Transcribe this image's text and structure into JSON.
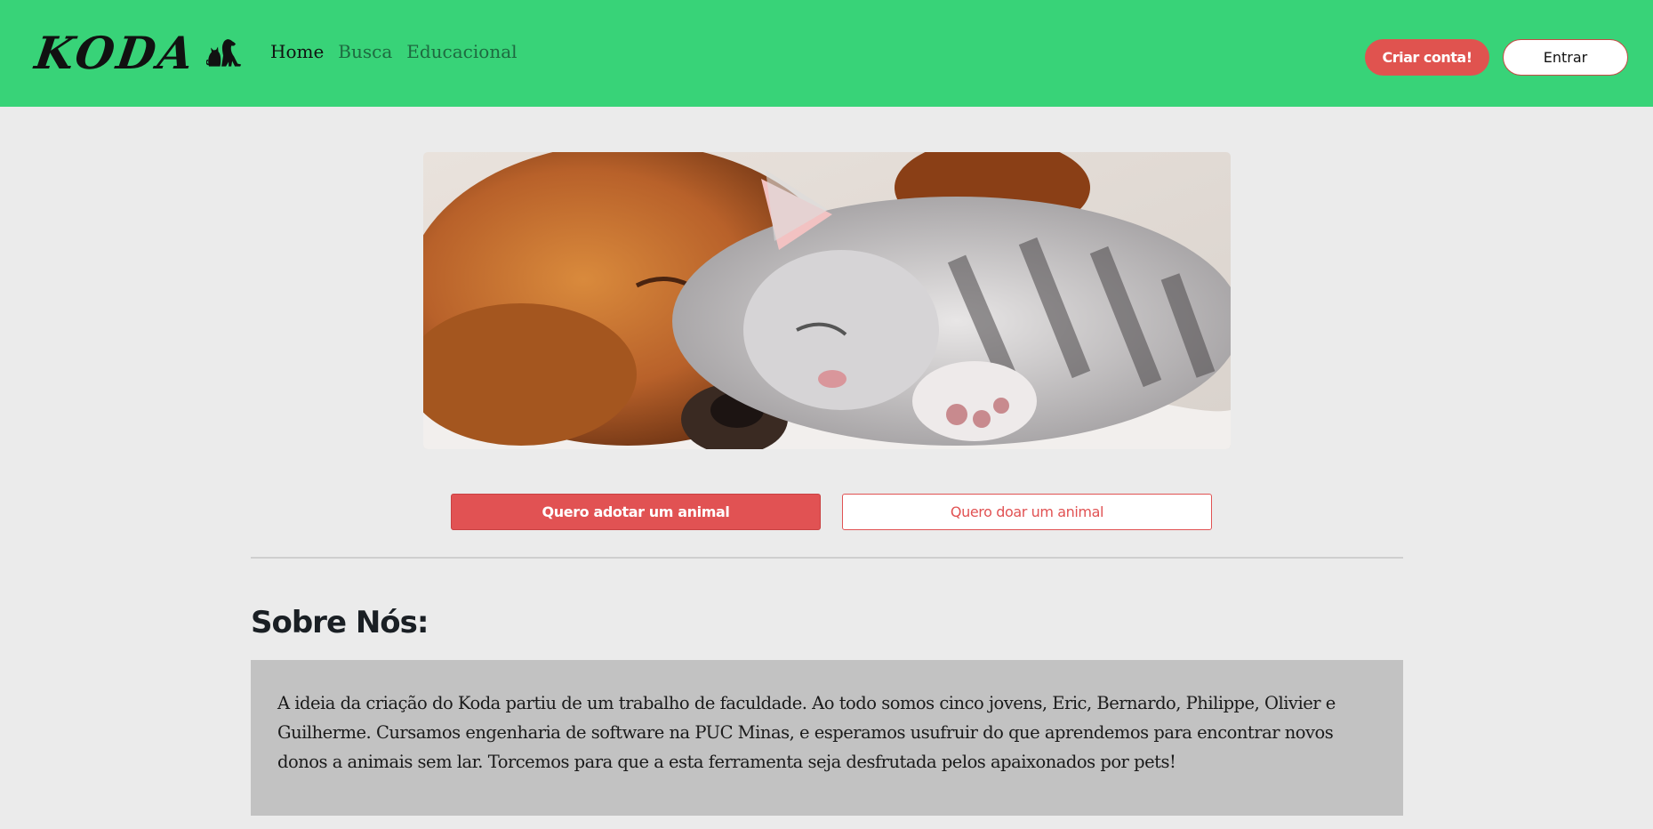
{
  "navbar": {
    "brand": "KODA",
    "brand_icon": "cat-and-dog-silhouette-icon",
    "links": [
      "Home",
      "Busca",
      "Educacional"
    ],
    "signup_label": "Criar conta!",
    "login_label": "Entrar",
    "background_color": "#38d378"
  },
  "hero": {
    "image_icon": "puppy-and-kitten-sleeping-photo"
  },
  "actions": {
    "adopt_label": "Quero adotar um animal",
    "donate_label": "Quero doar um animal",
    "accent_color": "#e15253"
  },
  "about": {
    "title": "Sobre Nós:",
    "text": "A ideia da criação do Koda partiu de um trabalho de faculdade. Ao todo somos cinco jovens, Eric, Bernardo, Philippe, Olivier e Guilherme. Cursamos engenharia de software na PUC Minas, e esperamos usufruir do que aprendemos para encontrar novos donos a animais sem lar. Torcemos para que a esta ferramenta seja desfrutada pelos apaixonados por pets!"
  }
}
